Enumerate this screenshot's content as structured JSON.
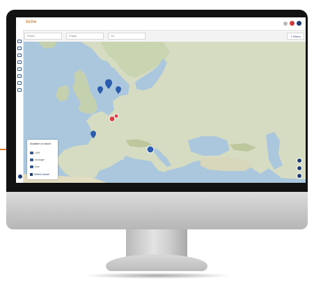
{
  "app": {
    "logo": "tiche"
  },
  "header": {
    "icons": [
      "user-icon",
      "notification-icon",
      "profile-icon"
    ]
  },
  "sidebar": {
    "items": [
      "map-icon",
      "vehicle-icon",
      "route-icon",
      "chart-icon",
      "location-icon",
      "calendar-icon",
      "document-icon",
      "settings-icon"
    ]
  },
  "filters": [
    {
      "placeholder": "Firmen"
    },
    {
      "placeholder": "Projekt"
    },
    {
      "placeholder": "Ort"
    }
  ],
  "filter_button": {
    "label": "≡ Filtern"
  },
  "legend": {
    "title": "Available on search",
    "rows": [
      {
        "label": "LKW"
      },
      {
        "label": "Anhänger"
      },
      {
        "label": "Kran"
      }
    ],
    "button": "Weitere Ansicht"
  },
  "colors": {
    "accent": "#e07b22",
    "brand": "#1f3f73",
    "sea": "#aac7de",
    "land": "#d5dcc2",
    "marker": "#2b5dad",
    "alert": "#d64040"
  }
}
